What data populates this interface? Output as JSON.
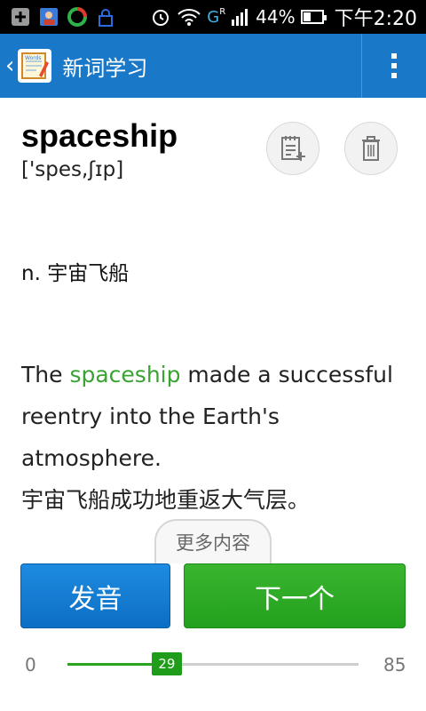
{
  "status_bar": {
    "battery": "44%",
    "network": "G",
    "roaming": "R",
    "time": "下午2:20",
    "battery_level": 0.44,
    "icons": [
      "add-icon",
      "contacts-icon",
      "app-icon",
      "alarm-icon",
      "wifi-icon",
      "signal-icon",
      "battery-icon"
    ]
  },
  "app_bar": {
    "title": "新词学习",
    "logo_text": "Words",
    "back_icon": "chevron-left-icon",
    "overflow_icon": "more-vert-icon",
    "color": "#1a78c8"
  },
  "word": {
    "headword": "spaceship",
    "phonetic": "['spes,ʃɪp]",
    "definition": "n. 宇宙飞船"
  },
  "example": {
    "before": "The ",
    "highlight": "spaceship",
    "after": " made a successful reentry into the Earth's atmosphere.",
    "translation": "宇宙飞船成功地重返大气层。",
    "highlight_color": "#3aa332"
  },
  "actions": {
    "notebook_icon": "add-to-notebook-icon",
    "delete_icon": "trash-icon",
    "more_label": "更多内容",
    "pronounce_label": "发音",
    "next_label": "下一个"
  },
  "progress": {
    "min": "0",
    "max": "85",
    "current": "29",
    "value": 29,
    "total": 85
  }
}
